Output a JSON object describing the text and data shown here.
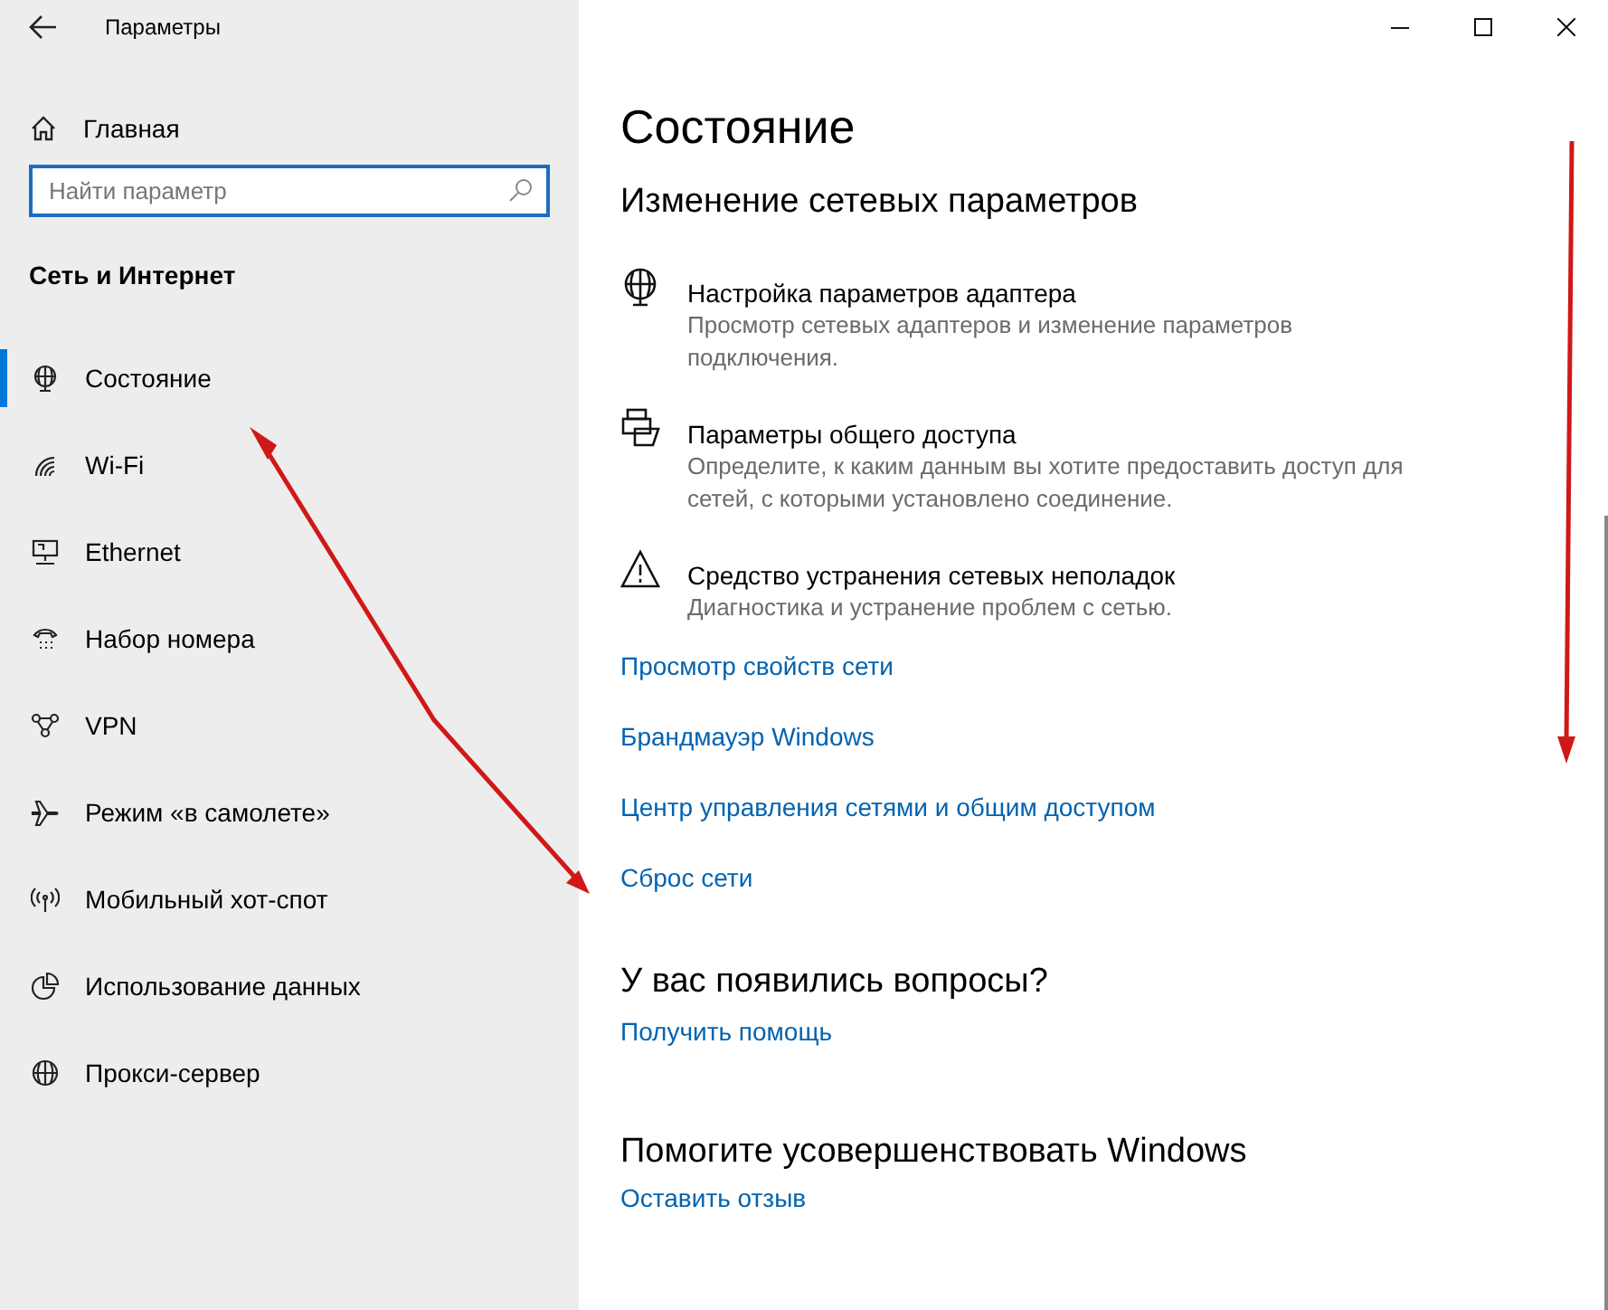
{
  "window": {
    "title": "Параметры"
  },
  "sidebar": {
    "home": "Главная",
    "search": {
      "placeholder": "Найти параметр"
    },
    "section": "Сеть и Интернет",
    "items": [
      {
        "label": "Состояние",
        "kind": "status",
        "selected": true
      },
      {
        "label": "Wi-Fi",
        "kind": "wifi",
        "selected": false
      },
      {
        "label": "Ethernet",
        "kind": "ethernet",
        "selected": false
      },
      {
        "label": "Набор номера",
        "kind": "dialup",
        "selected": false
      },
      {
        "label": "VPN",
        "kind": "vpn",
        "selected": false
      },
      {
        "label": "Режим «в самолете»",
        "kind": "airplane",
        "selected": false
      },
      {
        "label": "Мобильный хот-спот",
        "kind": "hotspot",
        "selected": false
      },
      {
        "label": "Использование данных",
        "kind": "data",
        "selected": false
      },
      {
        "label": "Прокси-сервер",
        "kind": "proxy",
        "selected": false
      }
    ]
  },
  "main": {
    "title": "Состояние",
    "heading": "Изменение сетевых параметров",
    "options": [
      {
        "kind": "adapter",
        "title": "Настройка параметров адаптера",
        "description": "Просмотр сетевых адаптеров и изменение параметров подключения."
      },
      {
        "kind": "sharing",
        "title": "Параметры общего доступа",
        "description": "Определите, к каким данным вы хотите предоставить доступ для сетей, с которыми установлено соединение."
      },
      {
        "kind": "warning",
        "title": "Средство устранения сетевых неполадок",
        "description": "Диагностика и устранение проблем с сетью."
      }
    ],
    "links": [
      "Просмотр свойств сети",
      "Брандмауэр Windows",
      "Центр управления сетями и общим доступом",
      "Сброс сети"
    ],
    "help": {
      "heading": "У вас появились вопросы?",
      "link": "Получить помощь"
    },
    "feedback": {
      "heading": "Помогите усовершенствовать Windows",
      "link": "Оставить отзыв"
    }
  }
}
